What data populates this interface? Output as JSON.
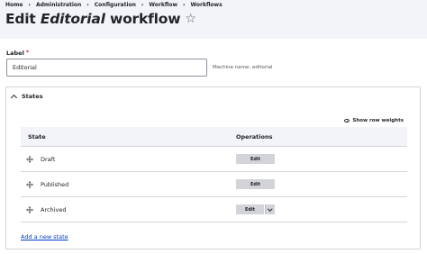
{
  "breadcrumb": [
    "Home",
    "Administration",
    "Configuration",
    "Workflow",
    "Workflows"
  ],
  "title": {
    "prefix": "Edit ",
    "emphasis": "Editorial",
    "suffix": " workflow"
  },
  "form": {
    "label": "Label",
    "required_mark": "*",
    "value": "Editorial",
    "machine_name": "Machine name: editorial"
  },
  "states_panel": {
    "summary": "States",
    "show_weights": "Show row weights",
    "columns": {
      "state": "State",
      "operations": "Operations"
    },
    "rows": [
      {
        "label": "Draft",
        "edit": "Edit",
        "has_dropdown": false
      },
      {
        "label": "Published",
        "edit": "Edit",
        "has_dropdown": false
      },
      {
        "label": "Archived",
        "edit": "Edit",
        "has_dropdown": true
      }
    ],
    "add_link": "Add a new state"
  },
  "colors": {
    "header_bg": "#f3f4f9",
    "link": "#003ecc",
    "required": "#dc2323",
    "button_bg": "#d3d4d9"
  },
  "icons": [
    "star-icon",
    "chevron-up-icon",
    "eye-icon",
    "drag-icon",
    "chevron-down-icon"
  ]
}
